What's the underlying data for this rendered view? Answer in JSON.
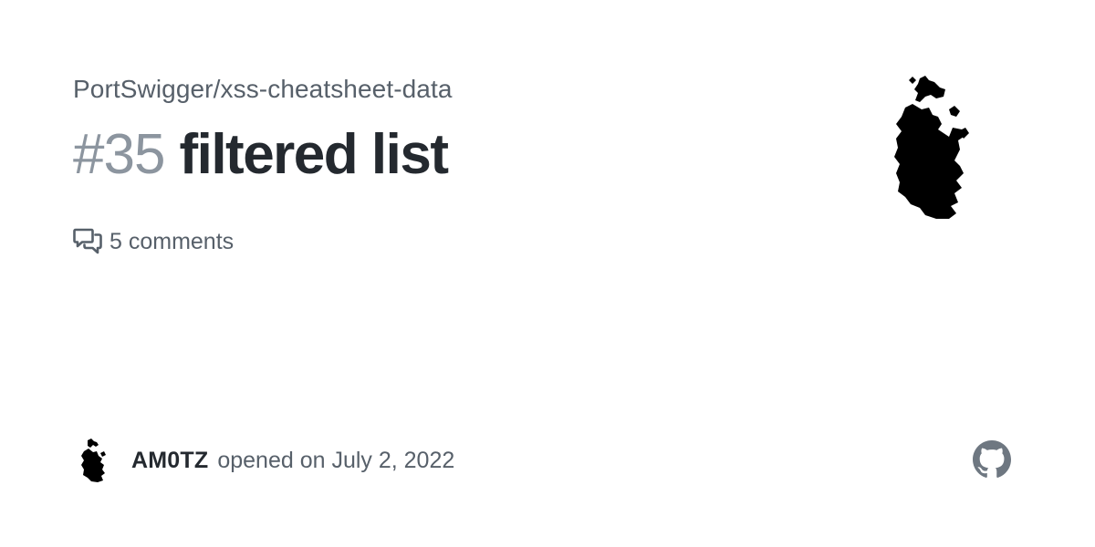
{
  "repo": {
    "full_name": "PortSwigger/xss-cheatsheet-data"
  },
  "issue": {
    "number": "#35",
    "title": "filtered list"
  },
  "comments": {
    "text": "5 comments",
    "icon": "comment-discussion-icon"
  },
  "author": {
    "name": "AM0TZ",
    "opened_text": "opened on July 2, 2022",
    "avatar_icon": "user-avatar"
  },
  "colors": {
    "muted_text": "#57606a",
    "number_gray": "#8c959f",
    "title_text": "#24292f",
    "github_logo": "#6e7781"
  },
  "icons": {
    "repo_avatar": "repo-owner-avatar",
    "brand": "github-mark-icon"
  }
}
